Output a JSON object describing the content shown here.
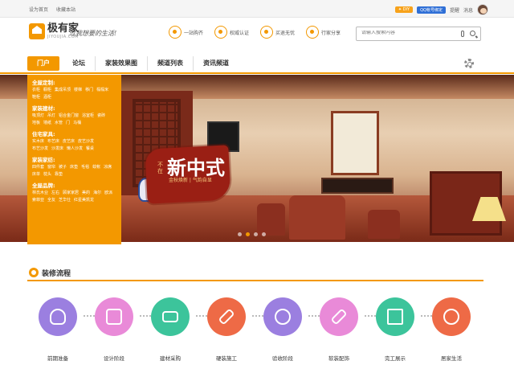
{
  "topbar": {
    "left_links": [
      "设为首页",
      "收藏本站"
    ],
    "diy_badge": "✦ DIY",
    "qq_badge": "QQ帐号绑定",
    "remind": "提醒",
    "messages": "消息"
  },
  "header": {
    "logo_title": "极有家",
    "logo_sub": "JIYOUJIA.COM",
    "slogan": "过我想要的生活!",
    "features": [
      {
        "label": "一站购齐",
        "icon": "cart-icon"
      },
      {
        "label": "权威认证",
        "icon": "certificate-icon"
      },
      {
        "label": "买退无忧",
        "icon": "shield-icon"
      },
      {
        "label": "行家分享",
        "icon": "share-icon"
      }
    ],
    "search_placeholder": "请输入搜索内容"
  },
  "nav": {
    "items": [
      "门户",
      "论坛",
      "家装效果图",
      "频道列表",
      "资讯频道"
    ]
  },
  "banner": {
    "promo_pre": "不在",
    "promo_title": "新中式",
    "promo_sub": "金秋焕新 | 气韵自显",
    "dots": 4,
    "active_dot": 2
  },
  "categories": [
    {
      "title": "全屋定制:",
      "links": [
        "衣柜",
        "橱柜",
        "集成吊顶",
        "楼梯",
        "移门",
        "榻榻米",
        "鞋柜",
        "酒柜"
      ]
    },
    {
      "title": "家装建材:",
      "links": [
        "吸顶灯",
        "吊灯",
        "铝合金门窗",
        "浴室柜",
        "瓷砖",
        "地板",
        "墙纸",
        "水管",
        "门",
        "马桶"
      ]
    },
    {
      "title": "住宅家具:",
      "links": [
        "实木床",
        "布艺床",
        "皮艺床",
        "皮艺沙发",
        "布艺沙发",
        "沙发床",
        "懒人沙发",
        "餐桌"
      ]
    },
    {
      "title": "家装家纺:",
      "links": [
        "四件套",
        "窗帘",
        "被子",
        "床垫",
        "毛毯",
        "蚊帐",
        "凉席",
        "床单",
        "枕头",
        "靠垫"
      ]
    },
    {
      "title": "全屋品牌:",
      "links": [
        "林氏木业",
        "左右",
        "顾家家居",
        "美的",
        "海尔",
        "欧派",
        "索菲亚",
        "全友",
        "芝华仕",
        "红星美凯龙"
      ]
    }
  ],
  "process": {
    "title": "装修流程",
    "steps": [
      {
        "label": "前期准备",
        "color": "#9b7fe0",
        "icon": "lightbulb-icon"
      },
      {
        "label": "设计阶段",
        "color": "#e98ad8",
        "icon": "design-icon"
      },
      {
        "label": "建材采购",
        "color": "#3cc49b",
        "icon": "truck-icon"
      },
      {
        "label": "硬装施工",
        "color": "#ee6a46",
        "icon": "brush-icon"
      },
      {
        "label": "验收阶段",
        "color": "#9b7fe0",
        "icon": "medal-icon"
      },
      {
        "label": "软装配饰",
        "color": "#e98ad8",
        "icon": "paint-roller-icon"
      },
      {
        "label": "完工展示",
        "color": "#3cc49b",
        "icon": "house-icon"
      },
      {
        "label": "居家生活",
        "color": "#ee6a46",
        "icon": "smile-icon"
      }
    ]
  }
}
